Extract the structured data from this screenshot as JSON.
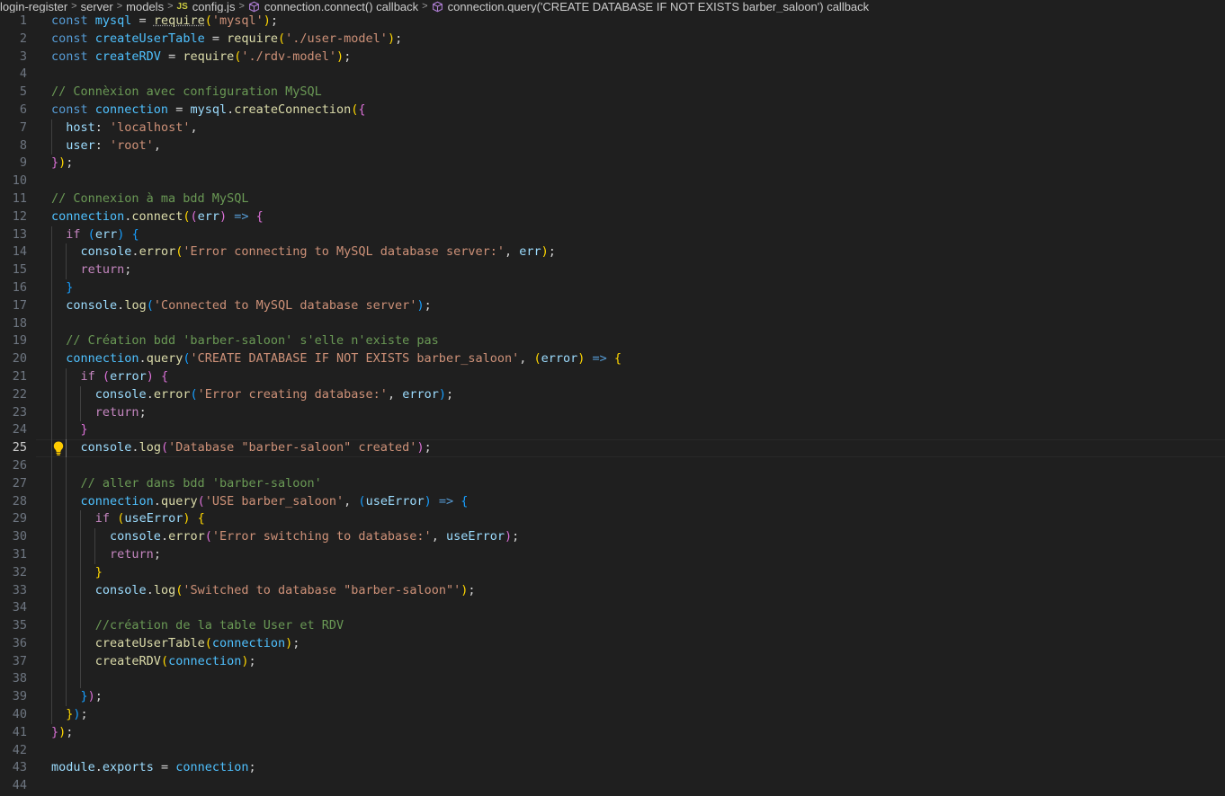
{
  "breadcrumb": {
    "items": [
      "login-register",
      "server",
      "models",
      "config.js",
      "connection.connect() callback",
      "connection.query('CREATE DATABASE IF NOT EXISTS barber_saloon') callback"
    ],
    "file_icon": "JS"
  },
  "editor": {
    "active_line": 25,
    "line_numbers": [
      "1",
      "2",
      "3",
      "4",
      "5",
      "6",
      "7",
      "8",
      "9",
      "10",
      "11",
      "12",
      "13",
      "14",
      "15",
      "16",
      "17",
      "18",
      "19",
      "20",
      "21",
      "22",
      "23",
      "24",
      "25",
      "26",
      "27",
      "28",
      "29",
      "30",
      "31",
      "32",
      "33",
      "34",
      "35",
      "36",
      "37",
      "38",
      "39",
      "40",
      "41",
      "42",
      "43",
      "44"
    ],
    "lines": [
      [
        [
          "kw",
          "const "
        ],
        [
          "cnst",
          "mysql"
        ],
        [
          "op",
          " = "
        ],
        [
          "fn",
          "require"
        ],
        [
          "p1",
          "("
        ],
        [
          "str",
          "'mysql'"
        ],
        [
          "p1",
          ")"
        ],
        [
          "op",
          ";"
        ]
      ],
      [
        [
          "kw",
          "const "
        ],
        [
          "cnst",
          "createUserTable"
        ],
        [
          "op",
          " = "
        ],
        [
          "fn",
          "require"
        ],
        [
          "p1",
          "("
        ],
        [
          "str",
          "'./user-model'"
        ],
        [
          "p1",
          ")"
        ],
        [
          "op",
          ";"
        ]
      ],
      [
        [
          "kw",
          "const "
        ],
        [
          "cnst",
          "createRDV"
        ],
        [
          "op",
          " = "
        ],
        [
          "fn",
          "require"
        ],
        [
          "p1",
          "("
        ],
        [
          "str",
          "'./rdv-model'"
        ],
        [
          "p1",
          ")"
        ],
        [
          "op",
          ";"
        ]
      ],
      [],
      [
        [
          "com",
          "// Connèxion avec configuration MySQL"
        ]
      ],
      [
        [
          "kw",
          "const "
        ],
        [
          "cnst",
          "connection"
        ],
        [
          "op",
          " = "
        ],
        [
          "var",
          "mysql"
        ],
        [
          "op",
          "."
        ],
        [
          "fn",
          "createConnection"
        ],
        [
          "p1",
          "("
        ],
        [
          "p2",
          "{"
        ]
      ],
      [
        [
          "op",
          "  "
        ],
        [
          "var",
          "host"
        ],
        [
          "op",
          ": "
        ],
        [
          "str",
          "'localhost'"
        ],
        [
          "op",
          ","
        ]
      ],
      [
        [
          "op",
          "  "
        ],
        [
          "var",
          "user"
        ],
        [
          "op",
          ": "
        ],
        [
          "str",
          "'root'"
        ],
        [
          "op",
          ","
        ]
      ],
      [
        [
          "p2",
          "}"
        ],
        [
          "p1",
          ")"
        ],
        [
          "op",
          ";"
        ]
      ],
      [],
      [
        [
          "com",
          "// Connexion à ma bdd MySQL"
        ]
      ],
      [
        [
          "cnst",
          "connection"
        ],
        [
          "op",
          "."
        ],
        [
          "fn",
          "connect"
        ],
        [
          "p1",
          "("
        ],
        [
          "p2",
          "("
        ],
        [
          "var",
          "err"
        ],
        [
          "p2",
          ")"
        ],
        [
          "kw",
          " => "
        ],
        [
          "p2",
          "{"
        ]
      ],
      [
        [
          "op",
          "  "
        ],
        [
          "ctrl",
          "if"
        ],
        [
          "op",
          " "
        ],
        [
          "p3",
          "("
        ],
        [
          "var",
          "err"
        ],
        [
          "p3",
          ")"
        ],
        [
          "op",
          " "
        ],
        [
          "p3",
          "{"
        ]
      ],
      [
        [
          "op",
          "    "
        ],
        [
          "var",
          "console"
        ],
        [
          "op",
          "."
        ],
        [
          "fn",
          "error"
        ],
        [
          "p1",
          "("
        ],
        [
          "str",
          "'Error connecting to MySQL database server:'"
        ],
        [
          "op",
          ", "
        ],
        [
          "var",
          "err"
        ],
        [
          "p1",
          ")"
        ],
        [
          "op",
          ";"
        ]
      ],
      [
        [
          "op",
          "    "
        ],
        [
          "ctrl",
          "return"
        ],
        [
          "op",
          ";"
        ]
      ],
      [
        [
          "op",
          "  "
        ],
        [
          "p3",
          "}"
        ]
      ],
      [
        [
          "op",
          "  "
        ],
        [
          "var",
          "console"
        ],
        [
          "op",
          "."
        ],
        [
          "fn",
          "log"
        ],
        [
          "p3",
          "("
        ],
        [
          "str",
          "'Connected to MySQL database server'"
        ],
        [
          "p3",
          ")"
        ],
        [
          "op",
          ";"
        ]
      ],
      [],
      [
        [
          "op",
          "  "
        ],
        [
          "com",
          "// Création bdd 'barber-saloon' s'elle n'existe pas"
        ]
      ],
      [
        [
          "op",
          "  "
        ],
        [
          "cnst",
          "connection"
        ],
        [
          "op",
          "."
        ],
        [
          "fn",
          "query"
        ],
        [
          "p3",
          "("
        ],
        [
          "str",
          "'CREATE DATABASE IF NOT EXISTS barber_saloon'"
        ],
        [
          "op",
          ", "
        ],
        [
          "p1",
          "("
        ],
        [
          "var",
          "error"
        ],
        [
          "p1",
          ")"
        ],
        [
          "kw",
          " => "
        ],
        [
          "p1",
          "{"
        ]
      ],
      [
        [
          "op",
          "    "
        ],
        [
          "ctrl",
          "if"
        ],
        [
          "op",
          " "
        ],
        [
          "p2",
          "("
        ],
        [
          "var",
          "error"
        ],
        [
          "p2",
          ")"
        ],
        [
          "op",
          " "
        ],
        [
          "p2",
          "{"
        ]
      ],
      [
        [
          "op",
          "      "
        ],
        [
          "var",
          "console"
        ],
        [
          "op",
          "."
        ],
        [
          "fn",
          "error"
        ],
        [
          "p3",
          "("
        ],
        [
          "str",
          "'Error creating database:'"
        ],
        [
          "op",
          ", "
        ],
        [
          "var",
          "error"
        ],
        [
          "p3",
          ")"
        ],
        [
          "op",
          ";"
        ]
      ],
      [
        [
          "op",
          "      "
        ],
        [
          "ctrl",
          "return"
        ],
        [
          "op",
          ";"
        ]
      ],
      [
        [
          "op",
          "    "
        ],
        [
          "p2",
          "}"
        ]
      ],
      [
        [
          "op",
          "    "
        ],
        [
          "var",
          "console"
        ],
        [
          "op",
          "."
        ],
        [
          "fn",
          "log"
        ],
        [
          "p2",
          "("
        ],
        [
          "str",
          "'Database \"barber-saloon\" created'"
        ],
        [
          "p2",
          ")"
        ],
        [
          "op",
          ";"
        ]
      ],
      [],
      [
        [
          "op",
          "    "
        ],
        [
          "com",
          "// aller dans bdd 'barber-saloon'"
        ]
      ],
      [
        [
          "op",
          "    "
        ],
        [
          "cnst",
          "connection"
        ],
        [
          "op",
          "."
        ],
        [
          "fn",
          "query"
        ],
        [
          "p2",
          "("
        ],
        [
          "str",
          "'USE barber_saloon'"
        ],
        [
          "op",
          ", "
        ],
        [
          "p3",
          "("
        ],
        [
          "var",
          "useError"
        ],
        [
          "p3",
          ")"
        ],
        [
          "kw",
          " => "
        ],
        [
          "p3",
          "{"
        ]
      ],
      [
        [
          "op",
          "      "
        ],
        [
          "ctrl",
          "if"
        ],
        [
          "op",
          " "
        ],
        [
          "p1",
          "("
        ],
        [
          "var",
          "useError"
        ],
        [
          "p1",
          ")"
        ],
        [
          "op",
          " "
        ],
        [
          "p1",
          "{"
        ]
      ],
      [
        [
          "op",
          "        "
        ],
        [
          "var",
          "console"
        ],
        [
          "op",
          "."
        ],
        [
          "fn",
          "error"
        ],
        [
          "p2",
          "("
        ],
        [
          "str",
          "'Error switching to database:'"
        ],
        [
          "op",
          ", "
        ],
        [
          "var",
          "useError"
        ],
        [
          "p2",
          ")"
        ],
        [
          "op",
          ";"
        ]
      ],
      [
        [
          "op",
          "        "
        ],
        [
          "ctrl",
          "return"
        ],
        [
          "op",
          ";"
        ]
      ],
      [
        [
          "op",
          "      "
        ],
        [
          "p1",
          "}"
        ]
      ],
      [
        [
          "op",
          "      "
        ],
        [
          "var",
          "console"
        ],
        [
          "op",
          "."
        ],
        [
          "fn",
          "log"
        ],
        [
          "p1",
          "("
        ],
        [
          "str",
          "'Switched to database \"barber-saloon\"'"
        ],
        [
          "p1",
          ")"
        ],
        [
          "op",
          ";"
        ]
      ],
      [],
      [
        [
          "op",
          "      "
        ],
        [
          "com",
          "//création de la table User et RDV"
        ]
      ],
      [
        [
          "op",
          "      "
        ],
        [
          "fn",
          "createUserTable"
        ],
        [
          "p1",
          "("
        ],
        [
          "cnst",
          "connection"
        ],
        [
          "p1",
          ")"
        ],
        [
          "op",
          ";"
        ]
      ],
      [
        [
          "op",
          "      "
        ],
        [
          "fn",
          "createRDV"
        ],
        [
          "p1",
          "("
        ],
        [
          "cnst",
          "connection"
        ],
        [
          "p1",
          ")"
        ],
        [
          "op",
          ";"
        ]
      ],
      [],
      [
        [
          "op",
          "    "
        ],
        [
          "p3",
          "}"
        ],
        [
          "p2",
          ")"
        ],
        [
          "op",
          ";"
        ]
      ],
      [
        [
          "op",
          "  "
        ],
        [
          "p1",
          "}"
        ],
        [
          "p3",
          ")"
        ],
        [
          "op",
          ";"
        ]
      ],
      [
        [
          "p2",
          "}"
        ],
        [
          "p1",
          ")"
        ],
        [
          "op",
          ";"
        ]
      ],
      [],
      [
        [
          "var",
          "module"
        ],
        [
          "op",
          "."
        ],
        [
          "var",
          "exports"
        ],
        [
          "op",
          " = "
        ],
        [
          "cnst",
          "connection"
        ],
        [
          "op",
          ";"
        ]
      ],
      []
    ],
    "indent_guides": [
      0,
      0,
      0,
      0,
      0,
      0,
      1,
      1,
      0,
      0,
      0,
      0,
      1,
      2,
      2,
      1,
      1,
      1,
      1,
      1,
      2,
      3,
      3,
      2,
      2,
      2,
      2,
      2,
      3,
      4,
      4,
      3,
      3,
      3,
      3,
      3,
      3,
      3,
      2,
      1,
      0,
      0,
      0,
      0
    ]
  }
}
